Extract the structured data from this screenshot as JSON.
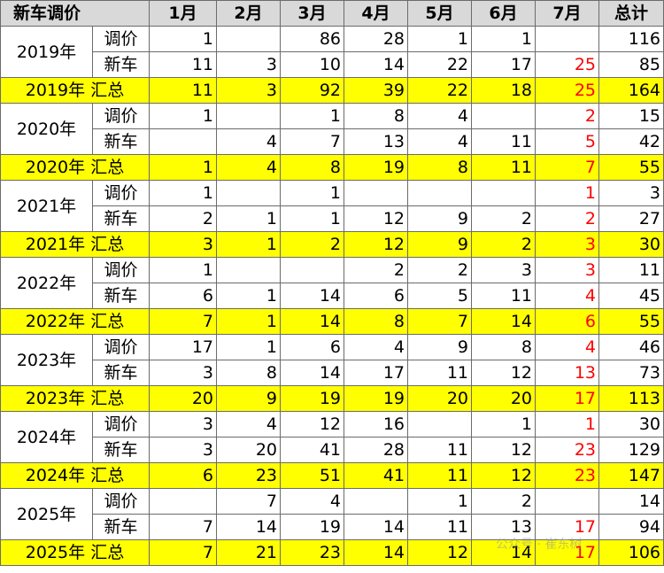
{
  "table": {
    "corner_label": "新车调价",
    "months": [
      "1月",
      "2月",
      "3月",
      "4月",
      "5月",
      "6月",
      "7月"
    ],
    "total_label": "总计",
    "sub_labels": {
      "adjust": "调价",
      "new": "新车"
    },
    "summary_suffix": "汇总",
    "years": [
      {
        "year": "2019年",
        "adjust": [
          "1",
          "",
          "86",
          "28",
          "1",
          "1",
          "",
          "116"
        ],
        "new": [
          "11",
          "3",
          "10",
          "14",
          "22",
          "17",
          "25",
          "85"
        ],
        "summary": [
          "11",
          "3",
          "92",
          "39",
          "22",
          "18",
          "25",
          "164"
        ]
      },
      {
        "year": "2020年",
        "adjust": [
          "1",
          "",
          "1",
          "8",
          "4",
          "",
          "2",
          "15"
        ],
        "new": [
          "",
          "4",
          "7",
          "13",
          "4",
          "11",
          "5",
          "42"
        ],
        "summary": [
          "1",
          "4",
          "8",
          "19",
          "8",
          "11",
          "7",
          "55"
        ]
      },
      {
        "year": "2021年",
        "adjust": [
          "1",
          "",
          "1",
          "",
          "",
          "",
          "1",
          "3"
        ],
        "new": [
          "2",
          "1",
          "1",
          "12",
          "9",
          "2",
          "2",
          "27"
        ],
        "summary": [
          "3",
          "1",
          "2",
          "12",
          "9",
          "2",
          "3",
          "30"
        ]
      },
      {
        "year": "2022年",
        "adjust": [
          "1",
          "",
          "",
          "2",
          "2",
          "3",
          "3",
          "11"
        ],
        "new": [
          "6",
          "1",
          "14",
          "6",
          "5",
          "11",
          "4",
          "45"
        ],
        "summary": [
          "7",
          "1",
          "14",
          "8",
          "7",
          "14",
          "6",
          "55"
        ]
      },
      {
        "year": "2023年",
        "adjust": [
          "17",
          "1",
          "6",
          "4",
          "9",
          "8",
          "4",
          "46"
        ],
        "new": [
          "3",
          "8",
          "14",
          "17",
          "11",
          "12",
          "13",
          "73"
        ],
        "summary": [
          "20",
          "9",
          "19",
          "19",
          "20",
          "20",
          "17",
          "113"
        ]
      },
      {
        "year": "2024年",
        "adjust": [
          "3",
          "4",
          "12",
          "16",
          "",
          "1",
          "1",
          "30"
        ],
        "new": [
          "3",
          "20",
          "41",
          "28",
          "11",
          "12",
          "23",
          "129"
        ],
        "summary": [
          "6",
          "23",
          "51",
          "41",
          "11",
          "12",
          "23",
          "147"
        ]
      },
      {
        "year": "2025年",
        "adjust": [
          "",
          "7",
          "4",
          "",
          "1",
          "2",
          "",
          "14"
        ],
        "new": [
          "7",
          "14",
          "19",
          "14",
          "11",
          "13",
          "17",
          "94"
        ],
        "summary": [
          "7",
          "21",
          "23",
          "14",
          "12",
          "14",
          "17",
          "106"
        ]
      }
    ]
  },
  "colors": {
    "header_bg": "#d9d9d9",
    "summary_bg": "#ffff00",
    "highlight_text": "#ff0000"
  },
  "watermark": "公众号 · 崔东树"
}
